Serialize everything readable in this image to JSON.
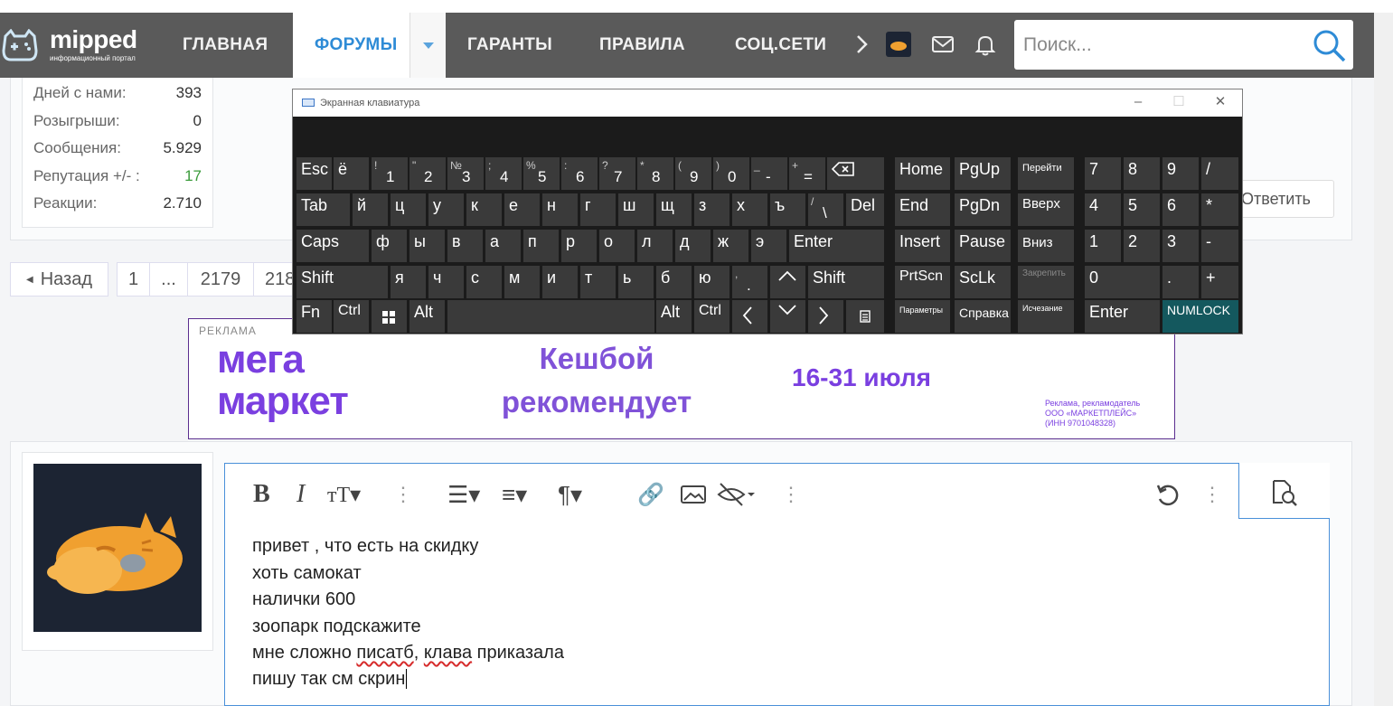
{
  "nav": {
    "logo_text": "mipped",
    "logo_sub": "информационный портал",
    "items": [
      {
        "label": "ГЛАВНАЯ"
      },
      {
        "label": "ФОРУМЫ"
      },
      {
        "label": "ГАРАНТЫ"
      },
      {
        "label": "ПРАВИЛА"
      },
      {
        "label": "СОЦ.СЕТИ"
      }
    ],
    "search_placeholder": "Поиск..."
  },
  "stats": {
    "rows": [
      {
        "label": "Дней с нами:",
        "value": "393"
      },
      {
        "label": "Розыгрыши:",
        "value": "0"
      },
      {
        "label": "Сообщения:",
        "value": "5.929"
      },
      {
        "label": "Репутация +/- :",
        "value": "17"
      },
      {
        "label": "Реакции:",
        "value": "2.710"
      }
    ],
    "reply_label": "Ответить"
  },
  "pager": {
    "back_label": "Назад",
    "pages": [
      "1",
      "...",
      "2179",
      "218"
    ]
  },
  "ad": {
    "label": "РЕКЛАМА",
    "brand_line1": "мега",
    "brand_line2": "маркет",
    "cash_line1": "Кешбой",
    "cash_line2": "рекомендует",
    "date": "16-31 июля",
    "legal": [
      "Реклама, рекламодатель",
      "ООО «МАРКЕТПЛЕЙС»",
      "(ИНН 9701048328)"
    ]
  },
  "editor": {
    "lines": [
      "привет , что есть на скидку",
      "хоть самокат",
      "налички 600",
      "зоопарк подскажите"
    ],
    "line5_a": "мне сложно ",
    "line5_err1": "писатб",
    "line5_b": ", ",
    "line5_err2": "клава",
    "line5_c": " приказала",
    "line6": "пишу так см скрин"
  },
  "osk": {
    "title": "Экранная клавиатура",
    "keys": {
      "esc": "Esc",
      "yo": "ё",
      "n1": "1",
      "n1s": "!",
      "n2": "2",
      "n2s": "\"",
      "n3": "3",
      "n3s": "№",
      "n4": "4",
      "n4s": ";",
      "n5": "5",
      "n5s": "%",
      "n6": "6",
      "n6s": ":",
      "n7": "7",
      "n7s": "?",
      "n8": "8",
      "n8s": "*",
      "n9": "9",
      "n9s": "(",
      "n0": "0",
      "n0s": ")",
      "minus": "-",
      "minus_s": "_",
      "eq": "=",
      "eq_s": "+",
      "tab": "Tab",
      "r1": [
        "й",
        "ц",
        "у",
        "к",
        "е",
        "н",
        "г",
        "ш",
        "щ",
        "з",
        "х",
        "ъ"
      ],
      "bslash": "\\",
      "bslash_s": "/",
      "del": "Del",
      "caps": "Caps",
      "r2": [
        "ф",
        "ы",
        "в",
        "а",
        "п",
        "р",
        "о",
        "л",
        "д",
        "ж",
        "э"
      ],
      "enter": "Enter",
      "shift": "Shift",
      "r3": [
        "я",
        "ч",
        "с",
        "м",
        "и",
        "т",
        "ь",
        "б",
        "ю"
      ],
      "dot": ".",
      "dot_s": ",",
      "fn": "Fn",
      "ctrl": "Ctrl",
      "alt": "Alt",
      "home": "Home",
      "pgup": "PgUp",
      "goto": "Перейти",
      "end": "End",
      "pgdn": "PgDn",
      "up": "Вверх",
      "insert": "Insert",
      "pause": "Pause",
      "down": "Вниз",
      "prtscn": "PrtScn",
      "sclk": "ScLk",
      "dock": "Закрепить",
      "params": "Параметры",
      "help": "Справка",
      "fade": "Исчезание",
      "np7": "7",
      "np8": "8",
      "np9": "9",
      "npdiv": "/",
      "np4": "4",
      "np5": "5",
      "np6": "6",
      "npmul": "*",
      "np1": "1",
      "np2": "2",
      "np3": "3",
      "npsub": "-",
      "np0": "0",
      "npdot": ".",
      "npadd": "+",
      "npenter": "Enter",
      "numlock": "NUMLOCK"
    }
  }
}
